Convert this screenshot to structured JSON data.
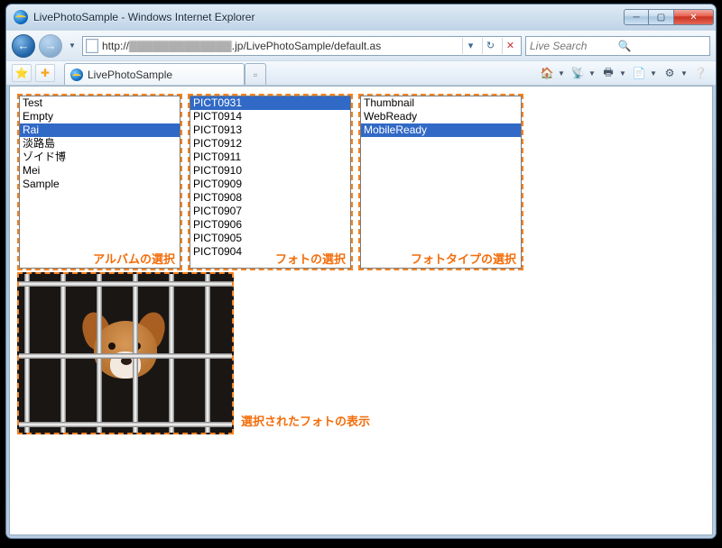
{
  "window": {
    "title": "LivePhotoSample - Windows Internet Explorer"
  },
  "nav": {
    "url_prefix": "http://",
    "url_blurred": "▓▓▓▓▓▓▓▓▓▓▓▓▓",
    "url_suffix": ".jp/LivePhotoSample/default.as",
    "search_placeholder": "Live Search"
  },
  "tab": {
    "title": "LivePhotoSample"
  },
  "panels": {
    "albums": {
      "caption": "アルバムの選択",
      "items": [
        "Test",
        "Empty",
        "Rai",
        "淡路島",
        "ゾイド博",
        "Mei",
        "Sample"
      ],
      "selected": "Rai"
    },
    "photos": {
      "caption": "フォトの選択",
      "items": [
        "PICT0931",
        "PICT0914",
        "PICT0913",
        "PICT0912",
        "PICT0911",
        "PICT0910",
        "PICT0909",
        "PICT0908",
        "PICT0907",
        "PICT0906",
        "PICT0905",
        "PICT0904"
      ],
      "selected": "PICT0931"
    },
    "types": {
      "caption": "フォトタイプの選択",
      "items": [
        "Thumbnail",
        "WebReady",
        "MobileReady"
      ],
      "selected": "MobileReady"
    }
  },
  "photo_caption": "選択されたフォトの表示"
}
